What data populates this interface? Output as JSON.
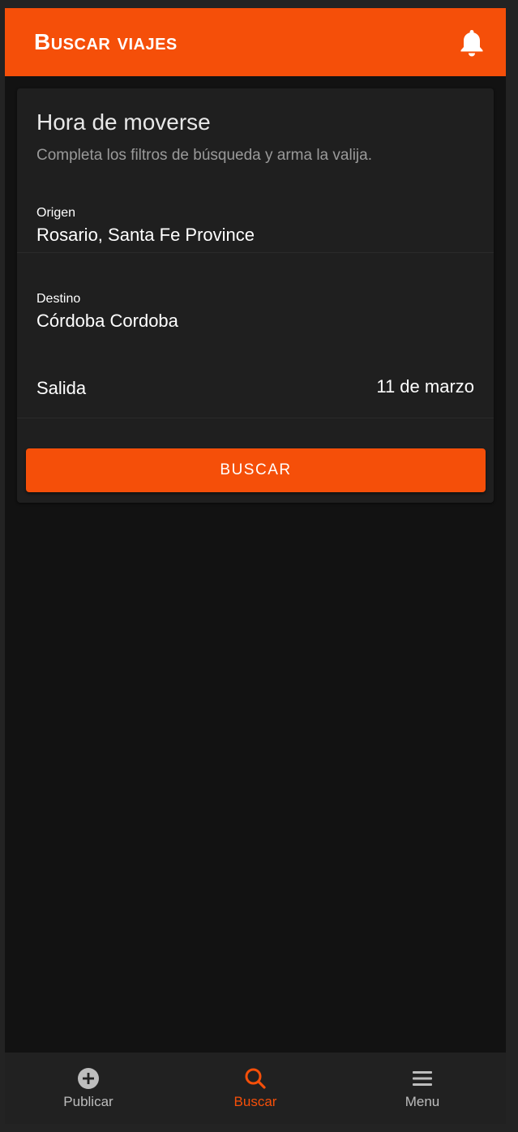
{
  "header": {
    "title": "Buscar viajes",
    "notification_icon": "bell-icon"
  },
  "card": {
    "title": "Hora de moverse",
    "subtitle": "Completa los filtros de búsqueda y arma la valija.",
    "origin": {
      "label": "Origen",
      "value": "Rosario, Santa Fe Province"
    },
    "destination": {
      "label": "Destino",
      "value": "Córdoba Cordoba"
    },
    "departure": {
      "label": "Salida",
      "value": "11 de marzo"
    },
    "search_button_label": "BUSCAR"
  },
  "bottom_nav": {
    "items": [
      {
        "label": "Publicar",
        "icon": "plus-circle-icon",
        "active": false
      },
      {
        "label": "Buscar",
        "icon": "search-icon",
        "active": true
      },
      {
        "label": "Menu",
        "icon": "menu-icon",
        "active": false
      }
    ]
  },
  "colors": {
    "accent": "#f54f09",
    "background": "#121212",
    "card": "#1f1f1f",
    "nav_inactive": "#bdbdbd"
  }
}
